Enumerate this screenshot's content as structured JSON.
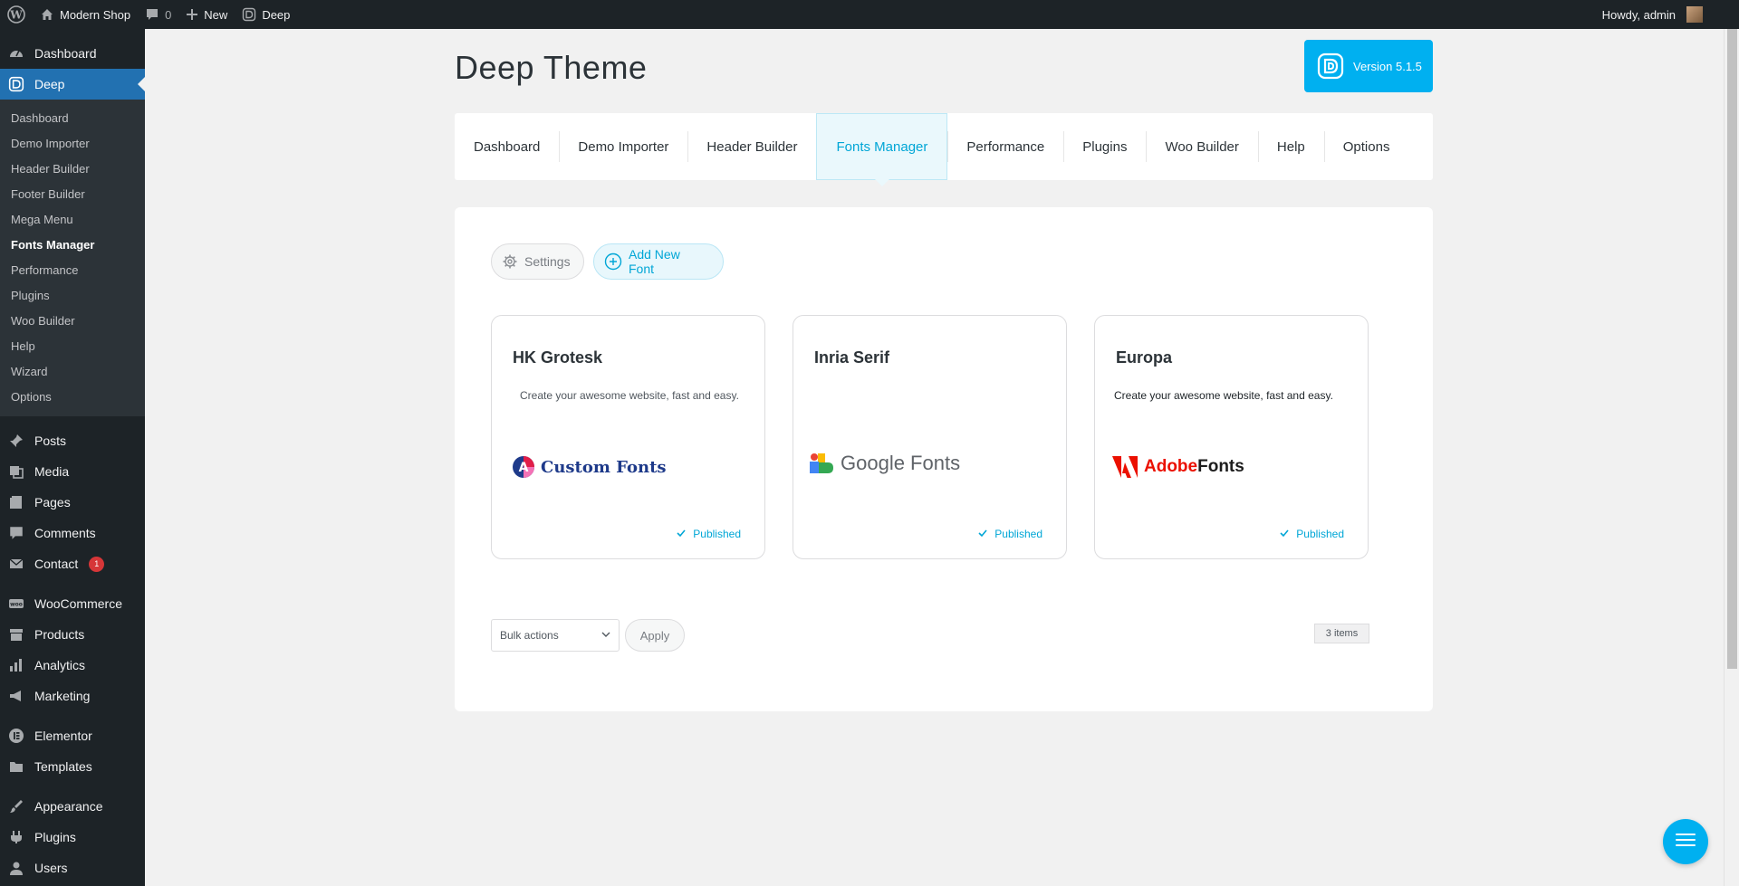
{
  "adminbar": {
    "site_name": "Modern Shop",
    "comments_count": "0",
    "new_label": "New",
    "deep_label": "Deep",
    "howdy": "Howdy, admin"
  },
  "sidebar": {
    "dashboard": "Dashboard",
    "deep": "Deep",
    "deep_submenu": [
      "Dashboard",
      "Demo Importer",
      "Header Builder",
      "Footer Builder",
      "Mega Menu",
      "Fonts Manager",
      "Performance",
      "Plugins",
      "Woo Builder",
      "Help",
      "Wizard",
      "Options"
    ],
    "active_submenu": "Fonts Manager",
    "group1": [
      "Posts",
      "Media",
      "Pages",
      "Comments",
      "Contact"
    ],
    "contact_badge": "1",
    "group2": [
      "WooCommerce",
      "Products",
      "Analytics",
      "Marketing"
    ],
    "group3": [
      "Elementor",
      "Templates"
    ],
    "group4": [
      "Appearance",
      "Plugins",
      "Users"
    ]
  },
  "page": {
    "title": "Deep Theme",
    "version_label": "Version 5.1.5"
  },
  "tabs": [
    {
      "label": "Dashboard"
    },
    {
      "label": "Demo Importer"
    },
    {
      "label": "Header Builder"
    },
    {
      "label": "Fonts Manager",
      "active": true
    },
    {
      "label": "Performance"
    },
    {
      "label": "Plugins"
    },
    {
      "label": "Woo Builder"
    },
    {
      "label": "Help"
    },
    {
      "label": "Options"
    }
  ],
  "toolbar": {
    "settings_label": "Settings",
    "add_font_label": "Add New Font"
  },
  "fonts": [
    {
      "name": "HK Grotesk",
      "description": "Create your awesome website, fast and easy.",
      "source": "Custom Fonts",
      "status": "Published"
    },
    {
      "name": "Inria Serif",
      "description": "",
      "source": "Google Fonts",
      "status": "Published"
    },
    {
      "name": "Europa",
      "description": "Create your awesome website, fast and easy.",
      "source_prefix": "Adobe",
      "source_suffix": "Fonts",
      "status": "Published"
    }
  ],
  "footer": {
    "bulk_actions": "Bulk actions",
    "apply_label": "Apply",
    "items_count": "3 items"
  },
  "colors": {
    "accent": "#00b0f0",
    "admin_dark": "#1d2327",
    "wp_blue": "#2271b1",
    "badge_red": "#d63638"
  }
}
